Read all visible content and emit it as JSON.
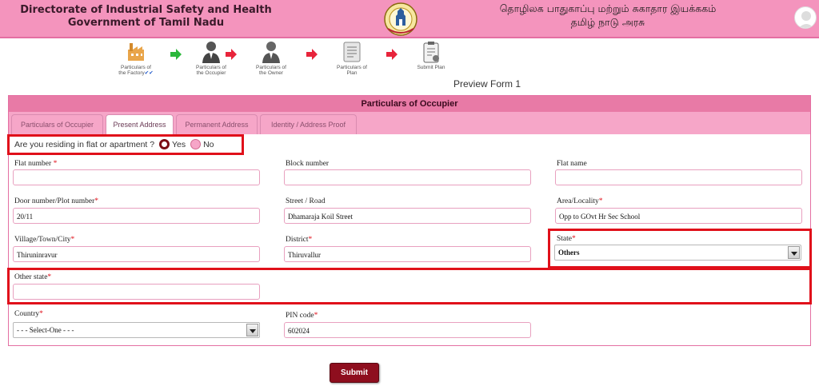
{
  "header": {
    "title_line1": "Directorate of Industrial Safety and Health",
    "title_line2": "Government of Tamil Nadu",
    "tamil_line1": "தொழிலக பாதுகாப்பு மற்றும் சுகாதார இயக்ககம்",
    "tamil_line2": "தமிழ் நாடு அரசு"
  },
  "steps": [
    {
      "label1": "Particulars of",
      "label2": "the Factory",
      "check": "✔✔"
    },
    {
      "label1": "Particulars of",
      "label2": "the Occupier"
    },
    {
      "label1": "Particulars of",
      "label2": "the Owner"
    },
    {
      "label1": "Particulars of",
      "label2": "Plan"
    },
    {
      "label1": "Submit Plan",
      "label2": ""
    }
  ],
  "preview_label": "Preview Form 1",
  "panel": {
    "title": "Particulars of Occupier",
    "tabs": [
      "Particulars of Occupier",
      "Present Address",
      "Permanent Address",
      "Identity / Address Proof"
    ]
  },
  "residing": {
    "question": "Are you residing in flat or apartment ?",
    "yes": "Yes",
    "no": "No",
    "selected": "Yes"
  },
  "fields": {
    "flat_number": {
      "label": "Flat number",
      "value": ""
    },
    "block_number": {
      "label": "Block number",
      "value": ""
    },
    "flat_name": {
      "label": "Flat name",
      "value": ""
    },
    "door_number": {
      "label": "Door number/Plot number",
      "value": "20/11"
    },
    "street": {
      "label": "Street / Road",
      "value": "Dhamaraja Koil Street"
    },
    "area": {
      "label": "Area/Locality",
      "value": "Opp to GOvt Hr Sec School"
    },
    "village": {
      "label": "Village/Town/City",
      "value": "Thiruninravur"
    },
    "district": {
      "label": "District",
      "value": "Thiruvallur"
    },
    "state": {
      "label": "State",
      "value": "Others"
    },
    "other_state": {
      "label": "Other state",
      "value": ""
    },
    "country": {
      "label": "Country",
      "value": "- - - Select-One - - -"
    },
    "pin": {
      "label": "PIN code",
      "value": "602024"
    }
  },
  "required_mark": "*",
  "submit_label": "Submit"
}
